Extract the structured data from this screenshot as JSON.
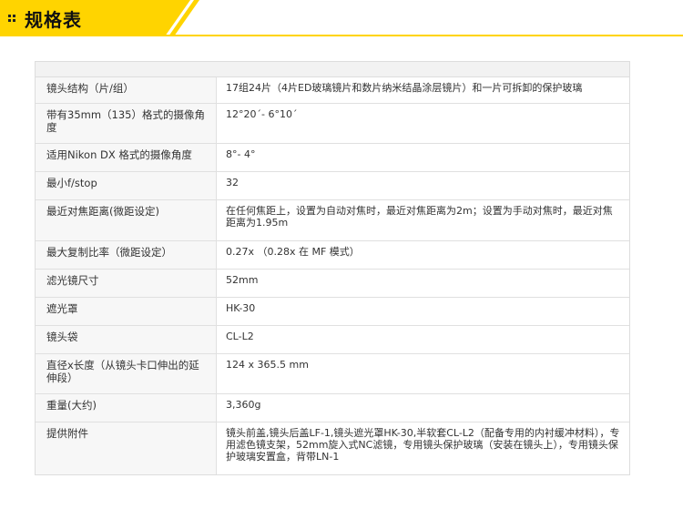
{
  "header": {
    "title": "规格表",
    "accent_color": "#ffd400"
  },
  "specs": [
    {
      "label": "镜头结构（片/组）",
      "value": "17组24片（4片ED玻璃镜片和数片纳米结晶涂层镜片）和一片可拆卸的保护玻璃"
    },
    {
      "label": "带有35mm（135）格式的摄像角度",
      "value": "12°20´- 6°10´"
    },
    {
      "label": "适用Nikon DX 格式的摄像角度",
      "value": "8°- 4°"
    },
    {
      "label": "最小f/stop",
      "value": "32"
    },
    {
      "label": "最近对焦距离(微距设定)",
      "value": "在任何焦距上，设置为自动对焦时，最近对焦距离为2m；设置为手动对焦时，最近对焦距离为1.95m"
    },
    {
      "label": "最大复制比率（微距设定）",
      "value": "0.27x （0.28x 在 MF 模式）"
    },
    {
      "label": "滤光镜尺寸",
      "value": "52mm"
    },
    {
      "label": "遮光罩",
      "value": "HK-30"
    },
    {
      "label": "镜头袋",
      "value": "CL-L2"
    },
    {
      "label": "直径x长度（从镜头卡口伸出的延伸段）",
      "value": "124 x 365.5 mm"
    },
    {
      "label": "重量(大约)",
      "value": "3,360g"
    },
    {
      "label": "提供附件",
      "value": "镜头前盖,镜头后盖LF-1,镜头遮光罩HK-30,半软套CL-L2（配备专用的内衬缓冲材料），专用滤色镜支架，52mm旋入式NC滤镜，专用镜头保护玻璃（安装在镜头上），专用镜头保护玻璃安置盒，背带LN-1"
    }
  ]
}
